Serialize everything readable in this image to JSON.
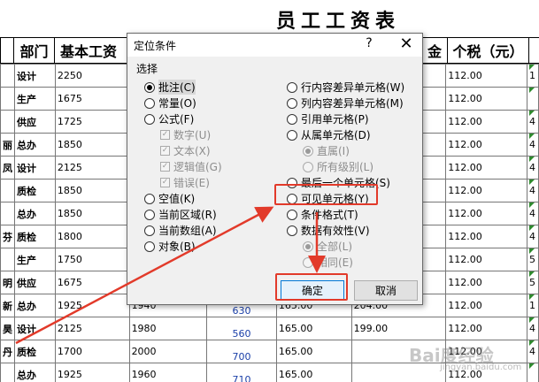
{
  "sheet": {
    "title": "员工工资表",
    "headers": [
      "部门",
      "基本工资",
      "金",
      "个税（元）"
    ],
    "rows": [
      {
        "name": "",
        "dept": "设计",
        "c3": "2250",
        "c4": "",
        "c5": "",
        "c6": "",
        "c7": "",
        "c8": "112.00",
        "c9": "1"
      },
      {
        "name": "",
        "dept": "生产",
        "c3": "1675",
        "c4": "",
        "c5": "",
        "c6": "",
        "c7": "",
        "c8": "112.00",
        "c9": ""
      },
      {
        "name": "",
        "dept": "供应",
        "c3": "1725",
        "c4": "",
        "c5": "",
        "c6": "",
        "c7": "",
        "c8": "112.00",
        "c9": "4"
      },
      {
        "name": "丽",
        "dept": "总办",
        "c3": "1850",
        "c4": "",
        "c5": "",
        "c6": "",
        "c7": "",
        "c8": "112.00",
        "c9": "4"
      },
      {
        "name": "凤",
        "dept": "设计",
        "c3": "2125",
        "c4": "",
        "c5": "",
        "c6": "",
        "c7": "",
        "c8": "112.00",
        "c9": "4"
      },
      {
        "name": "",
        "dept": "质检",
        "c3": "1850",
        "c4": "",
        "c5": "",
        "c6": "",
        "c7": "",
        "c8": "112.00",
        "c9": "4"
      },
      {
        "name": "",
        "dept": "总办",
        "c3": "1850",
        "c4": "",
        "c5": "",
        "c6": "",
        "c7": "",
        "c8": "112.00",
        "c9": "4"
      },
      {
        "name": "芬",
        "dept": "质检",
        "c3": "1800",
        "c4": "",
        "c5": "",
        "c6": "",
        "c7": "",
        "c8": "112.00",
        "c9": "4"
      },
      {
        "name": "",
        "dept": "生产",
        "c3": "1750",
        "c4": "",
        "c5": "",
        "c6": "",
        "c7": "",
        "c8": "112.00",
        "c9": "5"
      },
      {
        "name": "明",
        "dept": "供应",
        "c3": "1675",
        "c4": "",
        "c5": "",
        "c6": "",
        "c7": "",
        "c8": "112.00",
        "c9": "5"
      },
      {
        "name": "新",
        "dept": "总办",
        "c3": "1925",
        "c4": "1940",
        "c5": "630",
        "c6": "165.00",
        "c7": "204.00",
        "c8": "112.00",
        "c9": "1"
      },
      {
        "name": "昊",
        "dept": "设计",
        "c3": "2125",
        "c4": "1980",
        "c5": "560",
        "c6": "165.00",
        "c7": "199.00",
        "c8": "112.00",
        "c9": "4"
      },
      {
        "name": "丹",
        "dept": "质检",
        "c3": "1700",
        "c4": "2000",
        "c5": "700",
        "c6": "165.00",
        "c7": "",
        "c8": "112.00",
        "c9": "4"
      },
      {
        "name": "",
        "dept": "总办",
        "c3": "1925",
        "c4": "1960",
        "c5": "710",
        "c6": "165.00",
        "c7": "",
        "c8": "112.00",
        "c9": ""
      }
    ]
  },
  "dialog": {
    "title": "定位条件",
    "help": "?",
    "close": "✕",
    "group_label": "选择",
    "left_options": [
      "批注(C)",
      "常量(O)",
      "公式(F)",
      "数字(U)",
      "文本(X)",
      "逻辑值(G)",
      "错误(E)",
      "空值(K)",
      "当前区域(R)",
      "当前数组(A)",
      "对象(B)"
    ],
    "right_options": [
      "行内容差异单元格(W)",
      "列内容差异单元格(M)",
      "引用单元格(P)",
      "从属单元格(D)",
      "直属(I)",
      "所有级别(L)",
      "最后一个单元格(S)",
      "可见单元格(Y)",
      "条件格式(T)",
      "数据有效性(V)",
      "全部(L)",
      "相同(E)"
    ],
    "selected": "批注(C)",
    "ok_label": "确定",
    "cancel_label": "取消"
  },
  "annotations": {
    "accent_color": "#e23a2a"
  },
  "watermark": {
    "text": "Bai度经验",
    "sub": "jingyan.baidu.com"
  }
}
